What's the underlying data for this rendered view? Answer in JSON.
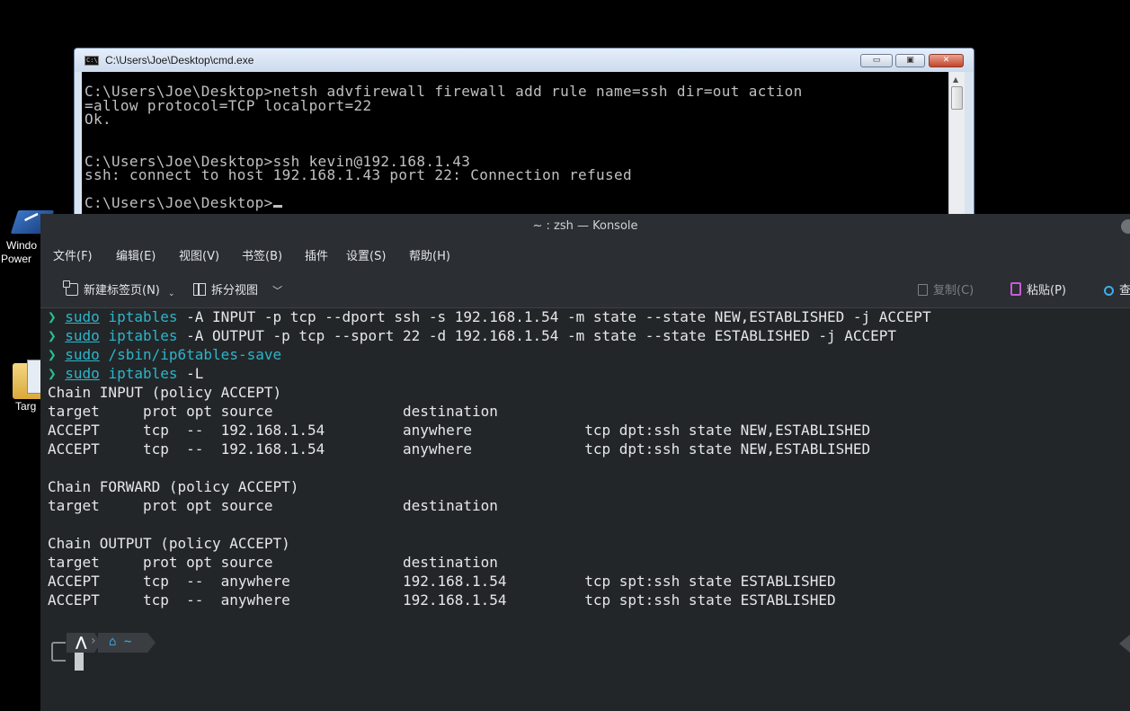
{
  "cmd": {
    "title": "C:\\Users\\Joe\\Desktop\\cmd.exe",
    "icon_text": "C:\\",
    "min_glyph": "▭",
    "max_glyph": "▣",
    "close_glyph": "✕",
    "scroll_glyph": "▲",
    "lines": [
      "C:\\Users\\Joe\\Desktop>netsh advfirewall firewall add rule name=ssh dir=out action",
      "=allow protocol=TCP localport=22",
      "Ok.",
      "",
      "",
      "C:\\Users\\Joe\\Desktop>ssh kevin@192.168.1.43",
      "ssh: connect to host 192.168.1.43 port 22: Connection refused",
      ""
    ],
    "last_prompt": "C:\\Users\\Joe\\Desktop>"
  },
  "desktop": {
    "icon1_label1": "Windo",
    "icon1_label2": "Power",
    "icon2_label": "Targ"
  },
  "konsole": {
    "title": "~ : zsh — Konsole",
    "menu": [
      "文件(F)",
      "编辑(E)",
      "视图(V)",
      "书签(B)",
      "插件",
      "设置(S)",
      "帮助(H)"
    ],
    "toolbar": {
      "new_tab": "新建标签页(N)",
      "split_view": "拆分视图",
      "copy": "复制(C)",
      "paste": "粘贴(P)",
      "find": "查"
    },
    "prompt_arrow": "❯",
    "commands": [
      {
        "sudo": "sudo",
        "cmd": "iptables",
        "args": " -A INPUT -p tcp --dport ssh -s 192.168.1.54 -m state --state NEW,ESTABLISHED -j ACCEPT"
      },
      {
        "sudo": "sudo",
        "cmd": "iptables",
        "args": " -A OUTPUT -p tcp --sport 22 -d 192.168.1.54 -m state --state ESTABLISHED -j ACCEPT"
      },
      {
        "sudo": "sudo",
        "cmd": "/sbin/ip6tables-save",
        "args": ""
      },
      {
        "sudo": "sudo",
        "cmd": "iptables",
        "args": " -L"
      }
    ],
    "output": [
      "Chain INPUT (policy ACCEPT)",
      "target     prot opt source               destination",
      "ACCEPT     tcp  --  192.168.1.54         anywhere             tcp dpt:ssh state NEW,ESTABLISHED",
      "ACCEPT     tcp  --  192.168.1.54         anywhere             tcp dpt:ssh state NEW,ESTABLISHED",
      "",
      "Chain FORWARD (policy ACCEPT)",
      "target     prot opt source               destination",
      "",
      "Chain OUTPUT (policy ACCEPT)",
      "target     prot opt source               destination",
      "ACCEPT     tcp  --  anywhere             192.168.1.54         tcp spt:ssh state ESTABLISHED",
      "ACCEPT     tcp  --  anywhere             192.168.1.54         tcp spt:ssh state ESTABLISHED"
    ],
    "prompt": {
      "arch_glyph": "⋀",
      "sep_glyph": "›",
      "home_glyph": "⌂",
      "dir": "~"
    }
  }
}
